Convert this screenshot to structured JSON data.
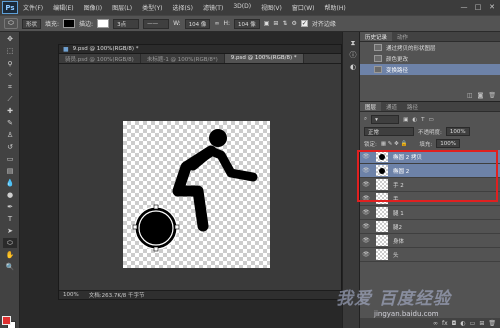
{
  "app": {
    "logo": "Ps"
  },
  "menu": [
    "文件(F)",
    "编辑(E)",
    "图像(I)",
    "图层(L)",
    "类型(Y)",
    "选择(S)",
    "滤镜(T)",
    "3D(D)",
    "视图(V)",
    "窗口(W)",
    "帮助(H)"
  ],
  "window_controls": [
    "—",
    "□",
    "✕"
  ],
  "options": {
    "shape_mode": "形状",
    "fill_label": "填充:",
    "stroke_label": "描边:",
    "stroke_width": "3点",
    "w_label": "W:",
    "w_value": "104 像",
    "h_label": "H:",
    "h_value": "104 像",
    "align_edges": "对齐边缘",
    "fill_color": "#000000",
    "stroke_color": "#ffffff"
  },
  "document": {
    "tabs": [
      "骑员.psd @ 100%(RGB/8)",
      "未标题-1 @ 100%(RGB/8*)",
      "9.psd @ 100%(RGB/8) *"
    ],
    "active_tab_index": 2,
    "title": "9.psd @ 100%(RGB/8) *",
    "zoom": "100%",
    "doc_info": "文档:263.7K/8 千字节"
  },
  "history": {
    "tabs": [
      "历史记录",
      "动作"
    ],
    "items": [
      {
        "label": "通过拷贝的形状图层",
        "selected": false
      },
      {
        "label": "颜色更改",
        "selected": false
      },
      {
        "label": "变换路径",
        "selected": true
      }
    ]
  },
  "layers": {
    "tabs": [
      "图层",
      "通道",
      "路径"
    ],
    "blend_mode": "正常",
    "opacity_label": "不透明度:",
    "opacity_value": "100%",
    "lock_label": "锁定:",
    "fill_label": "填充:",
    "fill_value": "100%",
    "items": [
      {
        "name": "椭圆 2 拷贝",
        "selected": true,
        "dot": true
      },
      {
        "name": "椭圆 2",
        "selected": true,
        "dot": true
      },
      {
        "name": "手 2",
        "selected": false,
        "dot": false
      },
      {
        "name": "手",
        "selected": false,
        "dot": false
      },
      {
        "name": "腿 1",
        "selected": false,
        "dot": false
      },
      {
        "name": "腿2",
        "selected": false,
        "dot": false
      },
      {
        "name": "身体",
        "selected": false,
        "dot": false
      },
      {
        "name": "头",
        "selected": false,
        "dot": false
      }
    ]
  },
  "watermark": {
    "text": "我爱 百度经验",
    "url": "jingyan.baidu.com"
  },
  "colors": {
    "selection": "#6d82a8",
    "highlight_box": "#e02020",
    "foreground": "#e03030"
  }
}
